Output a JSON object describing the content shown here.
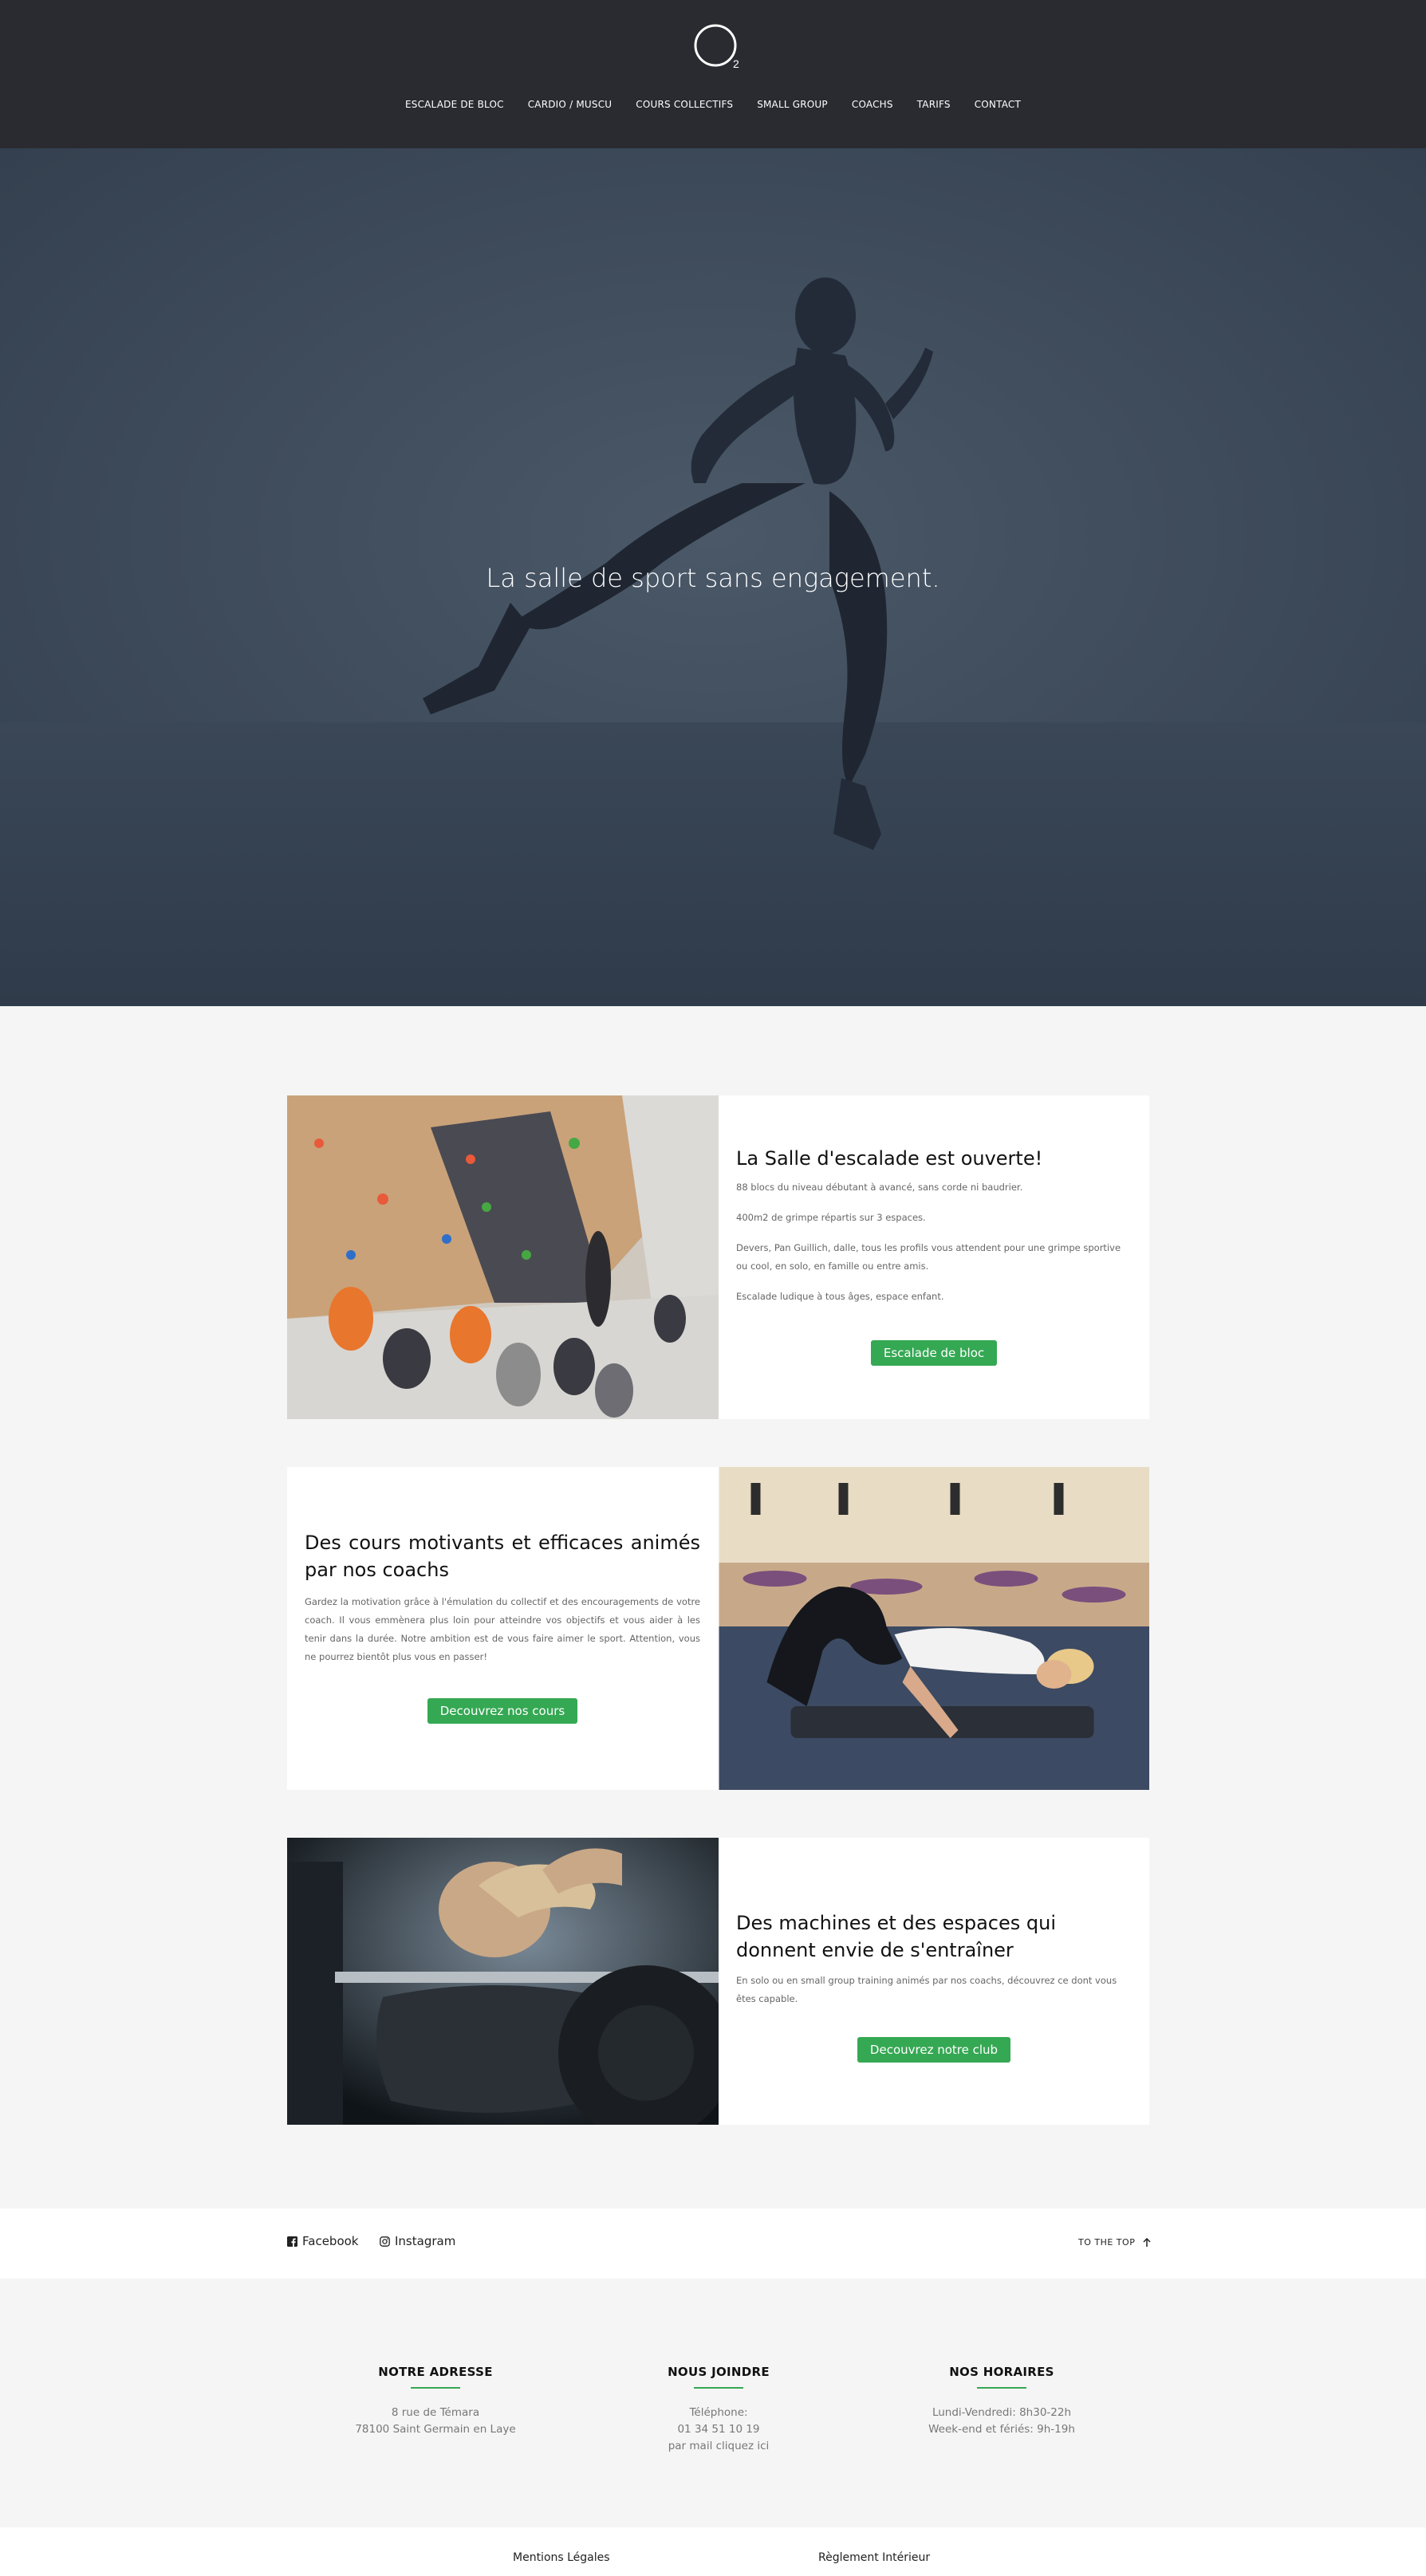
{
  "logo": {
    "mark": "O",
    "subscript": "2"
  },
  "nav": {
    "items": [
      {
        "label": "ESCALADE DE BLOC"
      },
      {
        "label": "CARDIO / MUSCU"
      },
      {
        "label": "COURS COLLECTIFS"
      },
      {
        "label": "SMALL GROUP"
      },
      {
        "label": "COACHS"
      },
      {
        "label": "TARIFS"
      },
      {
        "label": "CONTACT"
      }
    ]
  },
  "hero": {
    "title": "La salle de sport sans engagement."
  },
  "cards": [
    {
      "title": "La Salle d'escalade est ouverte!",
      "paragraphs": [
        "88 blocs du niveau débutant à avancé, sans corde ni baudrier.",
        "400m2 de grimpe répartis sur 3 espaces.",
        "Devers, Pan Guillich, dalle, tous les profils vous attendent pour une grimpe sportive ou cool, en solo, en famille ou entre amis.",
        "Escalade ludique à tous âges, espace enfant."
      ],
      "button": "Escalade de bloc"
    },
    {
      "title": "Des cours motivants et efficaces animés par nos coachs",
      "paragraphs": [
        "Gardez la motivation grâce à l'émulation du collectif et des encouragements de votre coach. Il vous emmènera plus loin pour atteindre vos objectifs et vous aider à les tenir dans la durée. Notre ambition est de vous faire aimer le sport. Attention, vous ne pourrez bientôt plus vous en passer!"
      ],
      "button": "Decouvrez nos cours"
    },
    {
      "title": "Des machines et des espaces qui donnent envie de s'entraîner",
      "paragraphs": [
        "En solo ou en small group training animés par nos coachs, découvrez ce dont vous êtes capable."
      ],
      "button": "Decouvrez notre club"
    }
  ],
  "social": {
    "facebook": "Facebook",
    "instagram": "Instagram",
    "to_top": "TO THE TOP"
  },
  "footer": {
    "columns": [
      {
        "title": "NOTRE ADRESSE",
        "lines": [
          "8 rue de Témara",
          "78100 Saint Germain en Laye"
        ]
      },
      {
        "title": "NOUS JOINDRE",
        "lines": [
          "Téléphone:",
          "01 34 51 10 19",
          "par mail cliquez ici"
        ]
      },
      {
        "title": "NOS HORAIRES",
        "lines": [
          "Lundi-Vendredi: 8h30-22h",
          "Week-end et fériés: 9h-19h"
        ]
      }
    ],
    "legal": "Mentions Légales",
    "rules": "Règlement Intérieur"
  },
  "colors": {
    "header_bg": "#2a2b31",
    "accent": "#35a853",
    "hero_overlay": "#3d4a5a"
  }
}
